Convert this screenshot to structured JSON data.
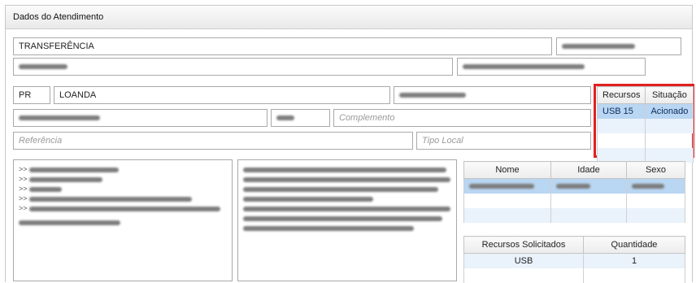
{
  "header": {
    "title": "Dados do Atendimento"
  },
  "service_type": "TRANSFERÊNCIA",
  "address": {
    "state": "PR",
    "city": "LOANDA",
    "complement_placeholder": "Complemento",
    "reference_placeholder": "Referência",
    "location_type_placeholder": "Tipo Local"
  },
  "resources_table": {
    "columns": [
      "Recursos",
      "Situação"
    ],
    "rows": [
      {
        "recurso": "USB 15",
        "situacao": "Acionado"
      }
    ]
  },
  "notes": {
    "left_prefix": ">>"
  },
  "patient_table": {
    "columns": [
      "Nome",
      "Idade",
      "Sexo"
    ]
  },
  "requested_table": {
    "columns": [
      "Recursos Solicitados",
      "Quantidade"
    ],
    "rows": [
      {
        "recurso": "USB",
        "quantidade": "1"
      }
    ]
  },
  "colors": {
    "highlight_border": "#e02020",
    "selected_row": "#b9d6f2"
  }
}
